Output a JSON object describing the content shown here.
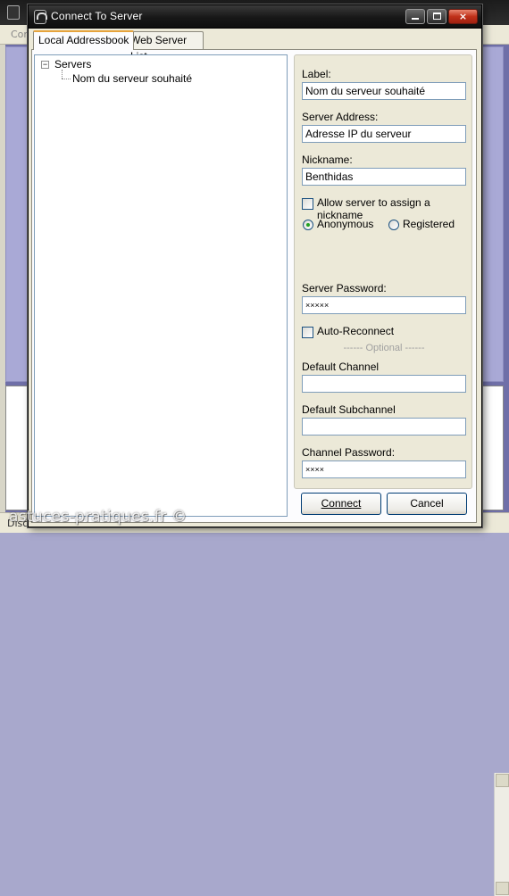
{
  "background_app": {
    "menu_partial": "Con",
    "status_partial": "Disco"
  },
  "dialog": {
    "title": "Connect To Server",
    "buttons": {
      "minimize": "minimize",
      "maximize": "maximize",
      "close": "×"
    }
  },
  "tabs": [
    {
      "label": "Local Addressbook",
      "active": true
    },
    {
      "label": "Web Server List",
      "active": false
    }
  ],
  "tree": {
    "expander": "−",
    "root": "Servers",
    "children": [
      "Nom du serveur souhaité"
    ]
  },
  "form": {
    "label_caption": "Label:",
    "label_value": "Nom du serveur souhaité",
    "address_caption": "Server Address:",
    "address_value": "Adresse IP du serveur",
    "nickname_caption": "Nickname:",
    "nickname_value": "Benthidas",
    "allow_nickname": {
      "label": "Allow server to assign a nickname",
      "checked": false
    },
    "auth_mode": {
      "options": [
        "Anonymous",
        "Registered"
      ],
      "selected": "Anonymous"
    },
    "server_password_caption": "Server Password:",
    "server_password_value": "×××××",
    "auto_reconnect": {
      "label": "Auto-Reconnect",
      "checked": false
    },
    "optional_label": "------ Optional ------",
    "default_channel_caption": "Default Channel",
    "default_channel_value": "",
    "default_subchannel_caption": "Default Subchannel",
    "default_subchannel_value": "",
    "channel_password_caption": "Channel Password:",
    "channel_password_value": "××××"
  },
  "actions": {
    "connect": "Connect",
    "cancel": "Cancel"
  },
  "watermark": "astuces-pratiques.fr ©",
  "colors": {
    "titlebar": "#171717",
    "close_button": "#c0311a",
    "dialog_face": "#ece9d8",
    "field_border": "#7f9db9",
    "background_pane": "#a9a9d6"
  }
}
